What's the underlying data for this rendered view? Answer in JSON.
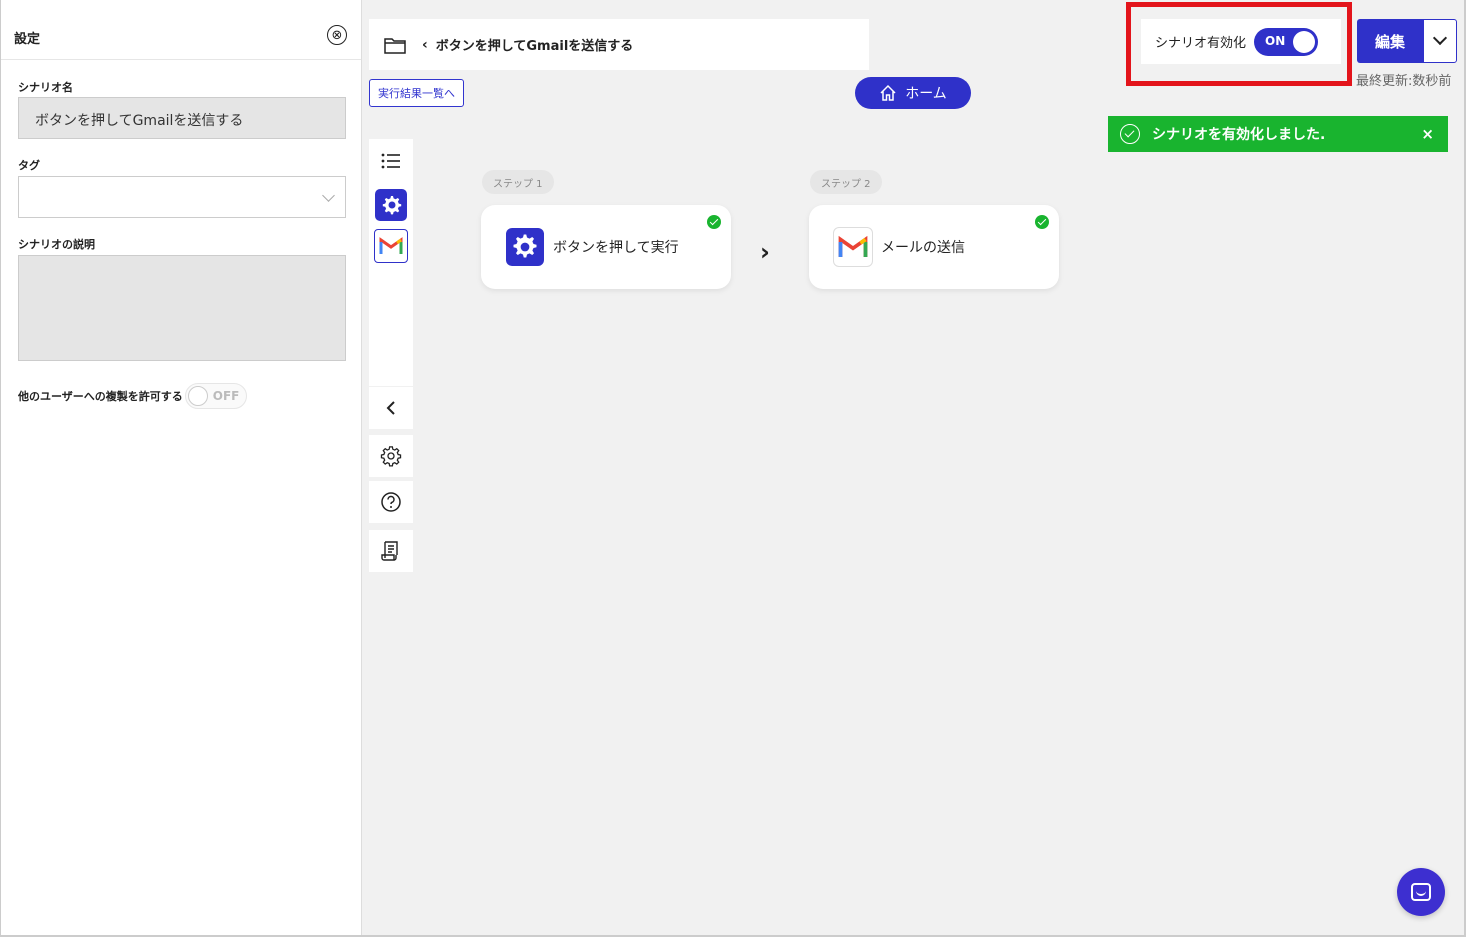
{
  "settings": {
    "title": "設定",
    "close_icon": "⊗",
    "name_label": "シナリオ名",
    "name_value": "ボタンを押してGmailを送信する",
    "tag_label": "タグ",
    "tag_value": "",
    "description_label": "シナリオの説明",
    "description_value": "",
    "copy_permission_label": "他のユーザーへの複製を許可する",
    "copy_permission_state": "OFF"
  },
  "header": {
    "folder_icon": "folder-icon",
    "back_icon": "‹",
    "scenario_title": "ボタンを押してGmailを送信する",
    "results_link": "実行結果一覧へ",
    "home_label": "ホーム"
  },
  "activation": {
    "label": "シナリオ有効化",
    "state": "ON"
  },
  "edit": {
    "label": "編集",
    "last_updated": "最終更新:数秒前"
  },
  "toast": {
    "message": "シナリオを有効化しました.",
    "close": "×"
  },
  "steps": [
    {
      "badge": "ステップ 1",
      "label": "ボタンを押して実行",
      "icon": "gear-icon",
      "status": "complete"
    },
    {
      "badge": "ステップ 2",
      "label": "メールの送信",
      "icon": "gmail-icon",
      "status": "complete"
    }
  ],
  "step_arrow": "›",
  "colors": {
    "accent": "#2f31c9",
    "success": "#19b42f",
    "highlight": "#e3141b"
  }
}
